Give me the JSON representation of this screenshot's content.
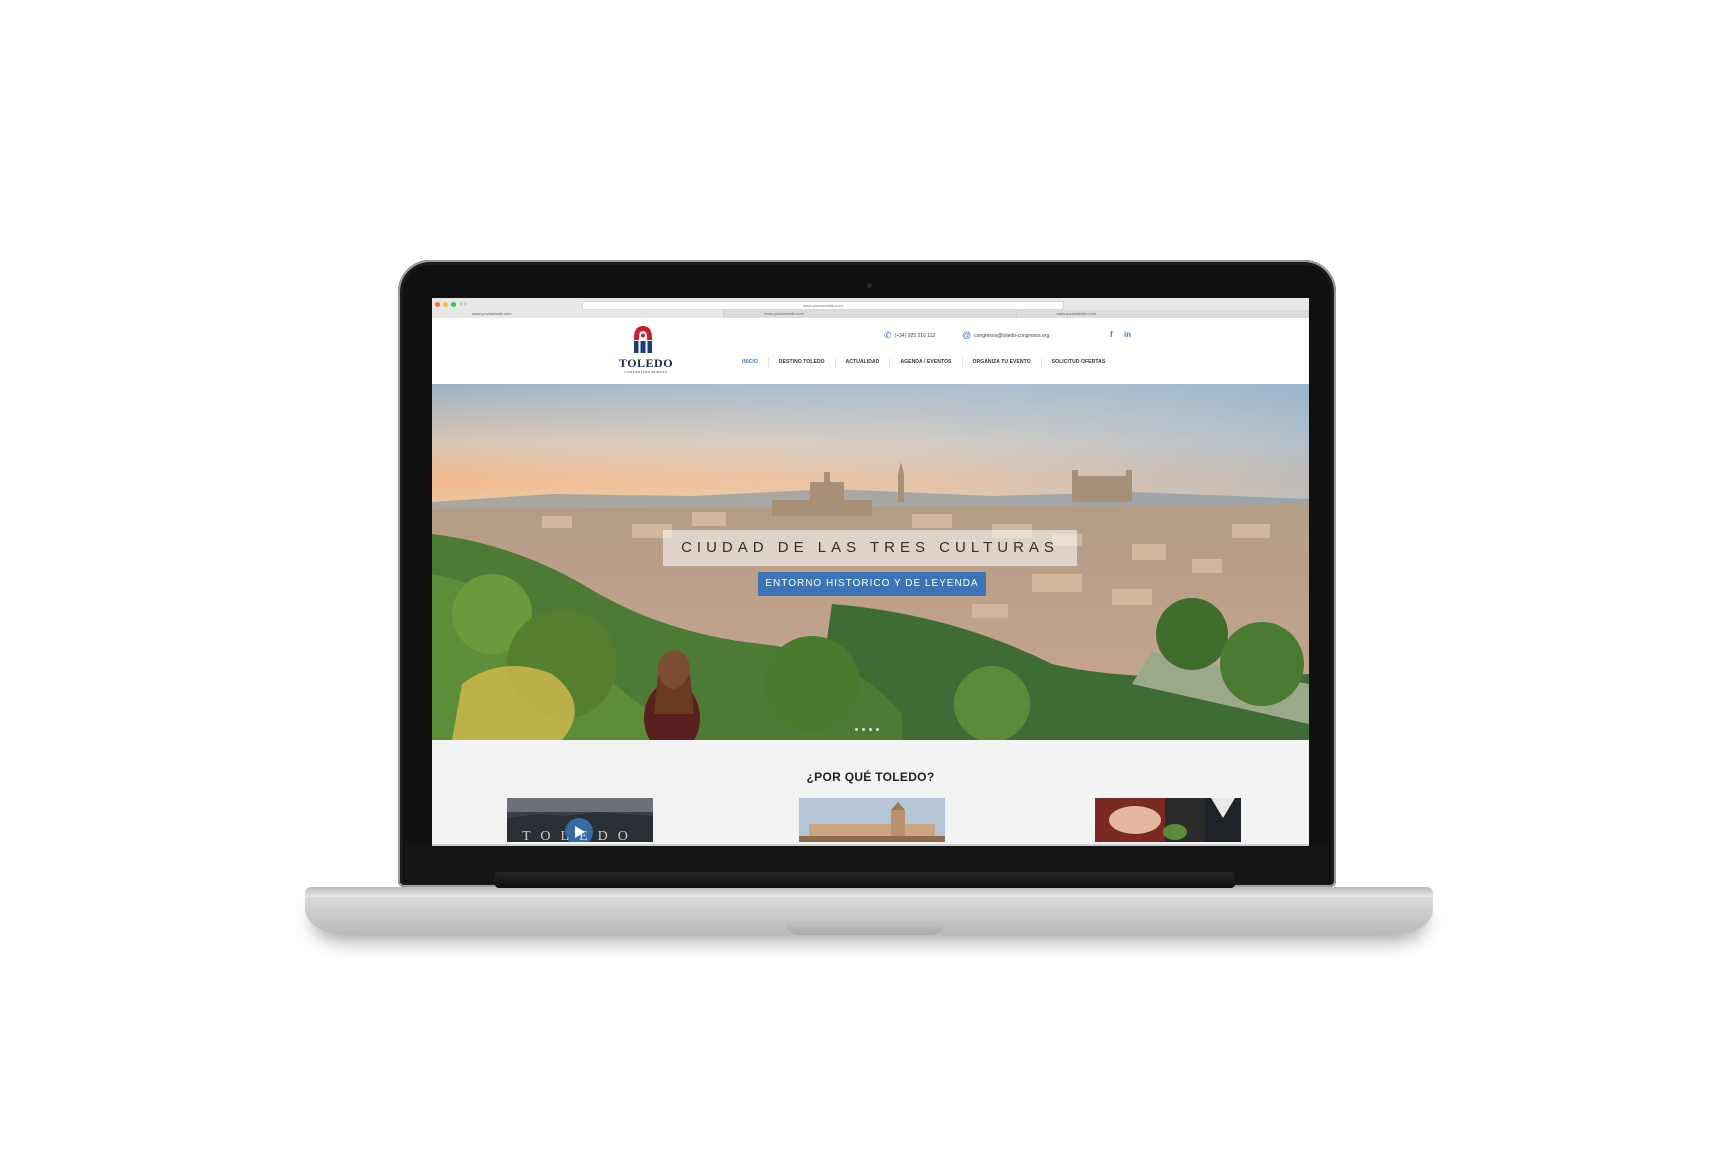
{
  "browser": {
    "address_url": "www.yourwebsite.com",
    "tabs": [
      {
        "label": "www.yourwebsite.com"
      },
      {
        "label": "www.yourwebsite.com"
      },
      {
        "label": "www.yourwebsite.com"
      }
    ]
  },
  "site": {
    "logo": {
      "name": "TOLEDO",
      "tagline": "CONVENTION BUREAU"
    },
    "contact": {
      "phone": "(+34) 925 210 112",
      "email": "congresos@toledo-congresos.org"
    },
    "social": [
      {
        "icon": "facebook-icon",
        "glyph": "f"
      },
      {
        "icon": "linkedin-icon",
        "glyph": "in"
      }
    ],
    "menu": [
      {
        "label": "INICIO",
        "active": true
      },
      {
        "label": "DESTINO TOLEDO",
        "active": false
      },
      {
        "label": "ACTUALIDAD",
        "active": false
      },
      {
        "label": "AGENDA / EVENTOS",
        "active": false
      },
      {
        "label": "ORGANIZA TU EVENTO",
        "active": false
      },
      {
        "label": "SOLICITUD OFERTAS",
        "active": false
      }
    ],
    "hero": {
      "title": "CIUDAD DE LAS TRES CULTURAS",
      "subtitle": "ENTORNO HISTORICO Y DE LEYENDA",
      "slides_count": 4
    },
    "why": {
      "title": "¿POR QUÉ TOLEDO?",
      "card1_overlay": "TOLEDO"
    }
  },
  "colors": {
    "accent": "#3d74b5",
    "logo_red": "#c8202f",
    "logo_blue": "#1c3b7a"
  }
}
